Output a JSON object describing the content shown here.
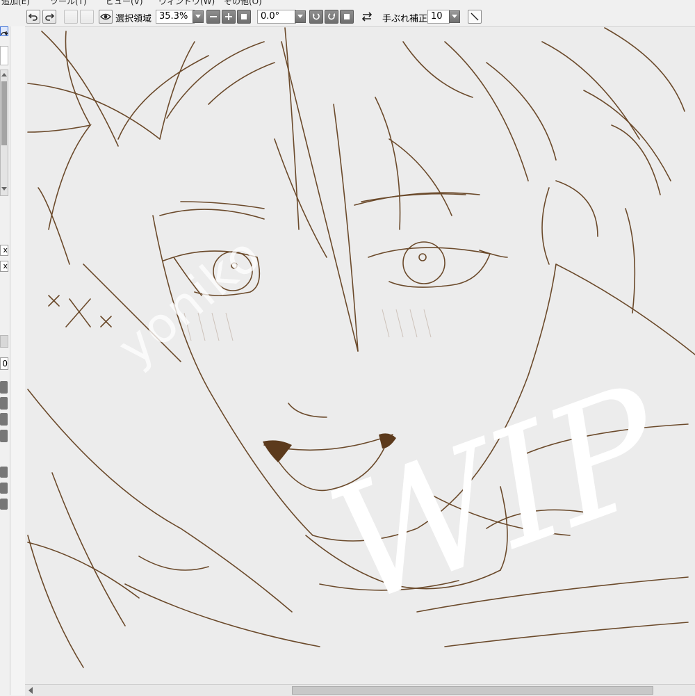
{
  "menu": {
    "items": [
      "追加(E)",
      "ツール(T)",
      "ビュー(V)",
      "ウィンドウ(W)",
      "その他(O)"
    ]
  },
  "toolbar": {
    "selection_label": "選択領域",
    "zoom_value": "35.3%",
    "rotation_value": "0.0°",
    "stabilizer_label": "手ぶれ補正",
    "stabilizer_value": "10"
  },
  "left_panel": {
    "close_glyphs": [
      "x",
      "x"
    ],
    "number_value": "0"
  },
  "canvas": {
    "watermark_text": "yoniko",
    "signature_text": "WIP"
  },
  "colors": {
    "sketch_line": "#6b4a2b",
    "canvas_bg": "#ececec",
    "toolbar_bg": "#f0f0f0",
    "accent": "#3a6fd8"
  }
}
